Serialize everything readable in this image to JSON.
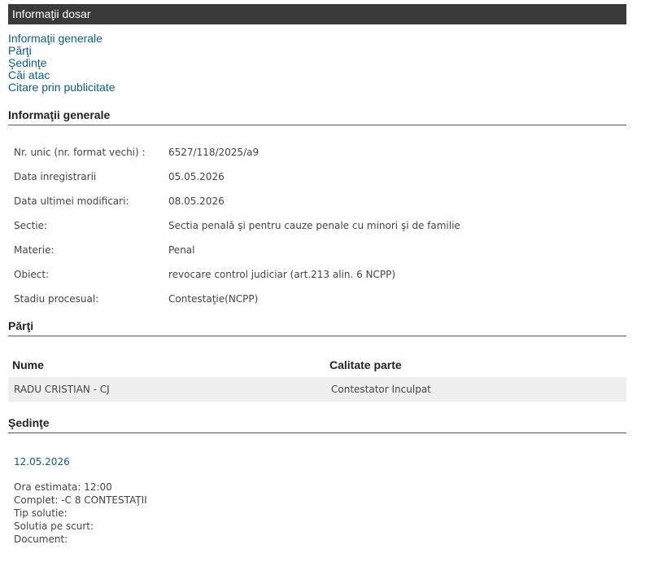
{
  "header": {
    "title": "Informaţii dosar"
  },
  "nav": {
    "items": [
      {
        "label": "Informaţii generale"
      },
      {
        "label": "Părţi"
      },
      {
        "label": "Şedinţe"
      },
      {
        "label": "Căi atac"
      },
      {
        "label": "Citare prin publicitate"
      }
    ]
  },
  "general": {
    "heading": "Informaţii generale",
    "rows": [
      {
        "label": "Nr. unic (nr. format vechi) :",
        "value": "6527/118/2025/a9"
      },
      {
        "label": "Data inregistrarii",
        "value": "05.05.2026"
      },
      {
        "label": "Data ultimei modificari:",
        "value": "08.05.2026"
      },
      {
        "label": "Sectie:",
        "value": "Sectia penală şi pentru cauze penale cu minori şi de familie"
      },
      {
        "label": "Materie:",
        "value": "Penal"
      },
      {
        "label": "Obiect:",
        "value": "revocare control judiciar (art.213 alin. 6 NCPP)"
      },
      {
        "label": "Stadiu procesual:",
        "value": "Contestaţie(NCPP)"
      }
    ]
  },
  "parti": {
    "heading": "Părţi",
    "columns": [
      "Nume",
      "Calitate parte"
    ],
    "rows": [
      {
        "nume": "RADU CRISTIAN - CJ",
        "calitate": "Contestator Inculpat"
      }
    ]
  },
  "sedinte": {
    "heading": "Şedinţe",
    "hearings": [
      {
        "date": "12.05.2026",
        "lines": [
          "Ora estimata: 12:00",
          "Complet: -C 8 CONTESTAŢII",
          "Tip solutie:",
          "Solutia pe scurt:",
          "Document:"
        ]
      }
    ]
  }
}
